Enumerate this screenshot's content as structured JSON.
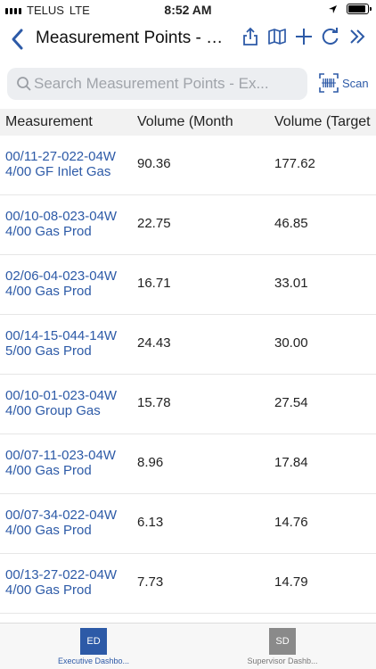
{
  "status": {
    "carrier": "TELUS",
    "network": "LTE",
    "time": "8:52 AM",
    "battery_level": 0.9
  },
  "nav": {
    "title": "Measurement Points - Execu…"
  },
  "search": {
    "placeholder": "Search Measurement Points - Ex...",
    "value": ""
  },
  "scan": {
    "label": "Scan"
  },
  "table": {
    "columns": [
      "Measurement",
      "Volume (Month",
      "Volume (Target"
    ],
    "rows": [
      {
        "line1": "00/11-27-022-04W",
        "line2": "4/00 GF Inlet Gas",
        "vol_month": "90.36",
        "vol_target": "177.62"
      },
      {
        "line1": "00/10-08-023-04W",
        "line2": "4/00 Gas Prod",
        "vol_month": "22.75",
        "vol_target": "46.85"
      },
      {
        "line1": "02/06-04-023-04W",
        "line2": "4/00 Gas Prod",
        "vol_month": "16.71",
        "vol_target": "33.01"
      },
      {
        "line1": "00/14-15-044-14W",
        "line2": "5/00 Gas Prod",
        "vol_month": "24.43",
        "vol_target": "30.00"
      },
      {
        "line1": "00/10-01-023-04W",
        "line2": "4/00 Group Gas",
        "vol_month": "15.78",
        "vol_target": "27.54"
      },
      {
        "line1": "00/07-11-023-04W",
        "line2": "4/00 Gas Prod",
        "vol_month": "8.96",
        "vol_target": "17.84"
      },
      {
        "line1": "00/07-34-022-04W",
        "line2": "4/00 Gas Prod",
        "vol_month": "6.13",
        "vol_target": "14.76"
      },
      {
        "line1": "00/13-27-022-04W",
        "line2": "4/00 Gas Prod",
        "vol_month": "7.73",
        "vol_target": "14.79"
      }
    ]
  },
  "tabs": [
    {
      "icon_text": "ED",
      "label": "Executive Dashbo...",
      "color": "#2d5aa7",
      "label_color": "#2d5aa7"
    },
    {
      "icon_text": "SD",
      "label": "Supervisor Dashb...",
      "color": "#8a8a8a",
      "label_color": "#777777"
    }
  ],
  "colors": {
    "accent": "#2d5aa7"
  },
  "icons": [
    "back-chevron-icon",
    "share-icon",
    "map-icon",
    "add-icon",
    "refresh-icon",
    "double-chevron-icon",
    "search-icon",
    "barcode-icon"
  ]
}
